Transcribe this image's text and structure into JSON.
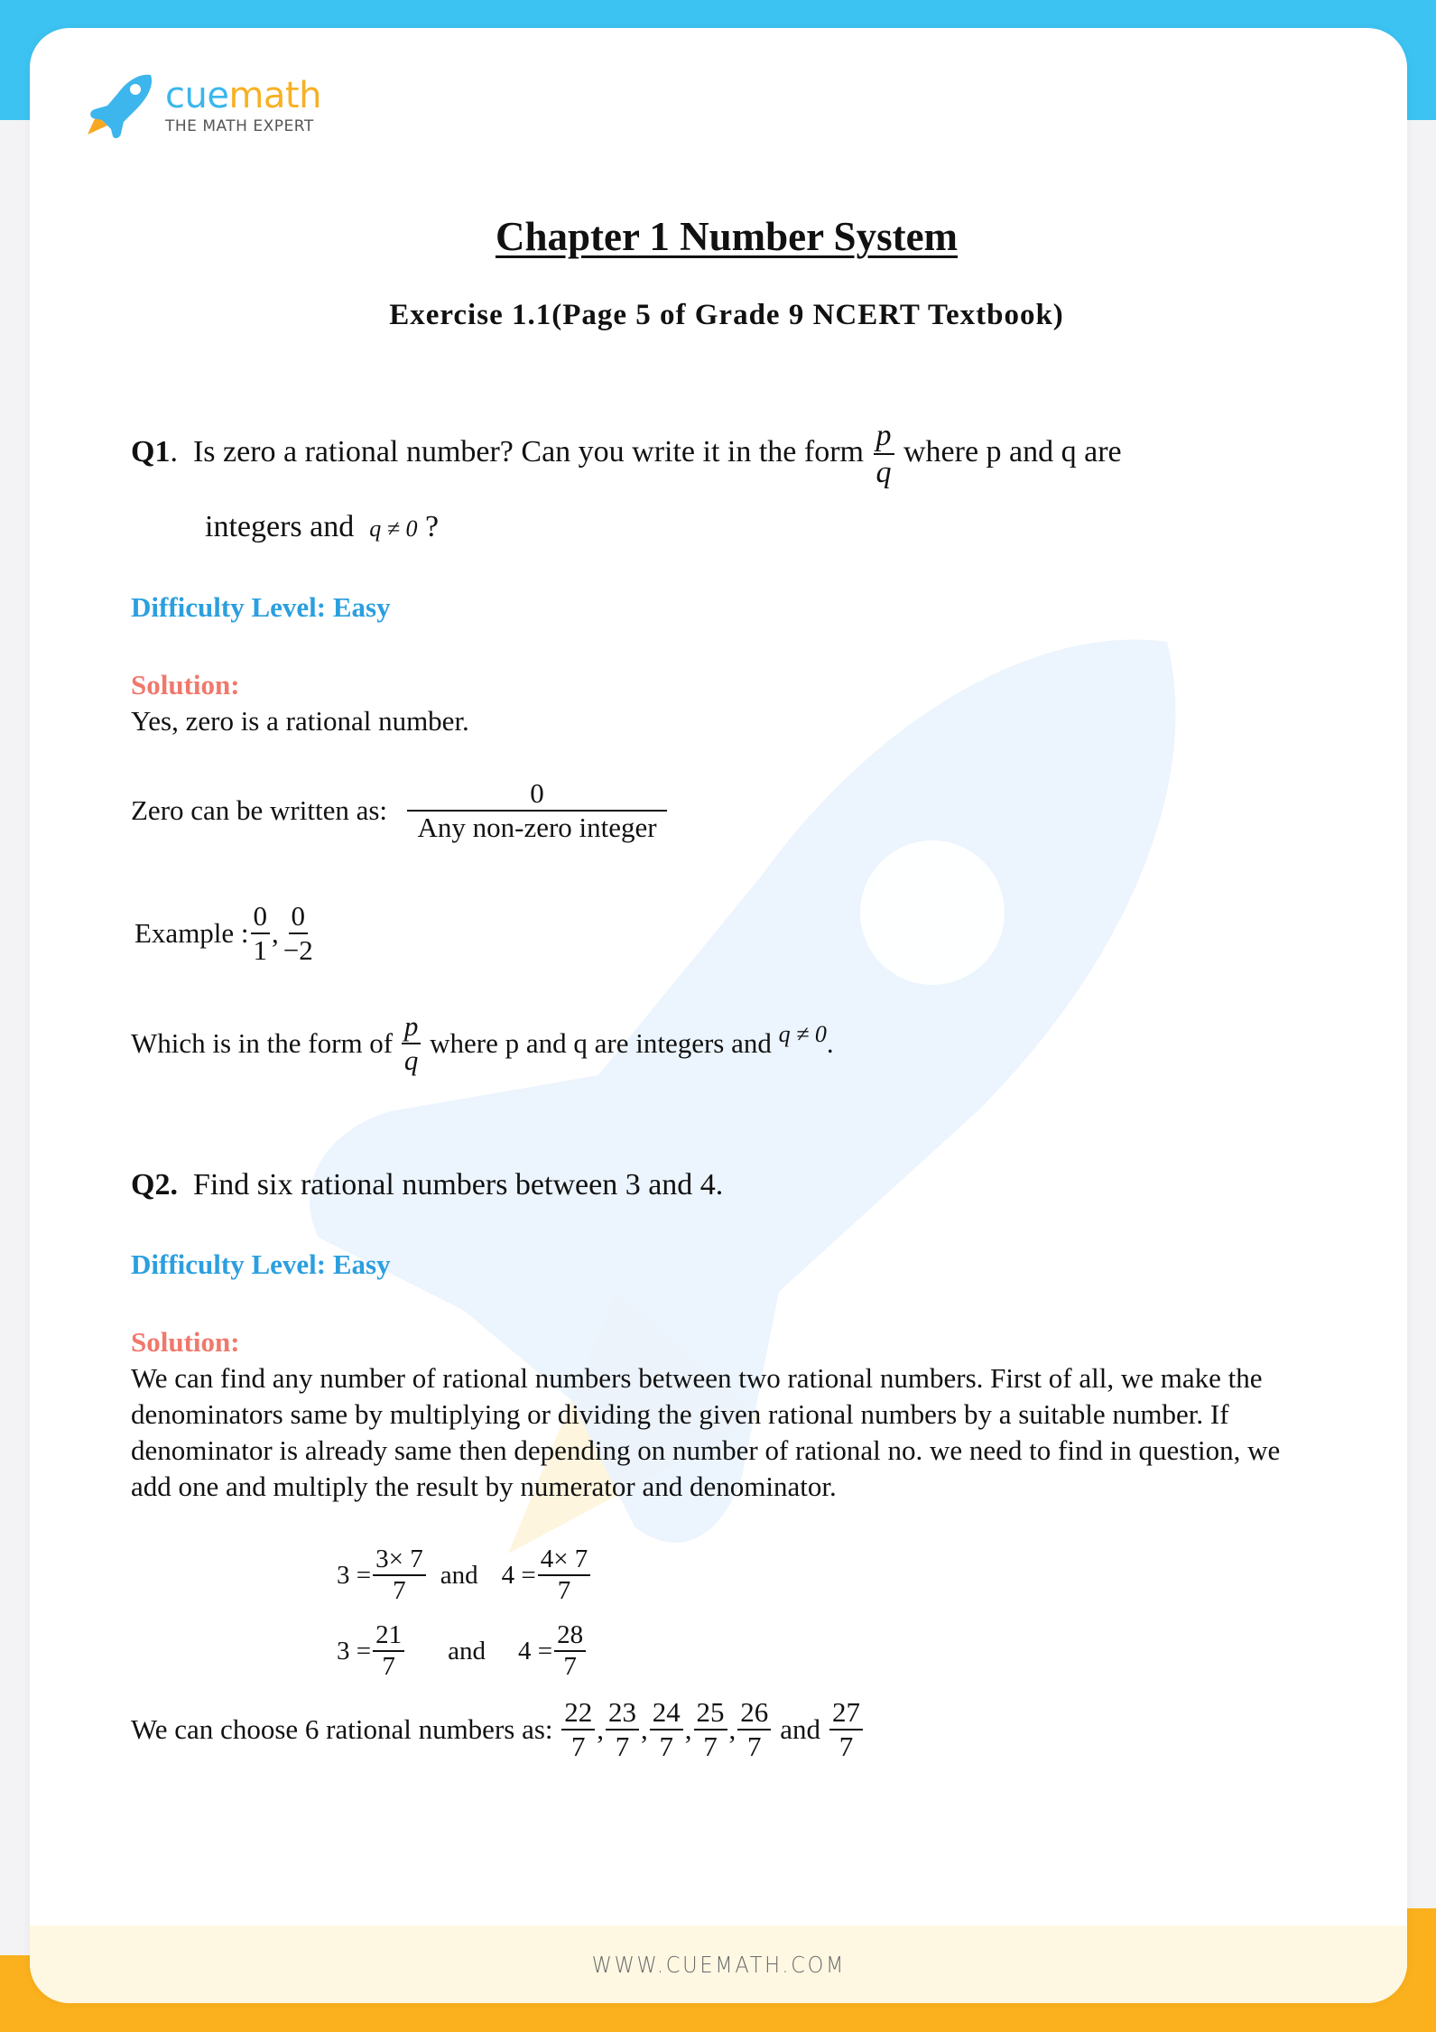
{
  "brand": {
    "name_part1": "cue",
    "name_part2": "math",
    "tagline": "THE MATH EXPERT",
    "colors": {
      "top_band": "#3cc3f2",
      "bottom_band": "#fbb11d",
      "difficulty": "#2c9fdf",
      "solution": "#f1786c",
      "footer_bg": "#fef8e3"
    }
  },
  "header": {
    "title": "Chapter 1 Number System",
    "subtitle": "Exercise 1.1(Page 5 of Grade 9 NCERT Textbook)"
  },
  "q1": {
    "label": "Q1",
    "label_suffix": ".",
    "text_before": "Is zero a rational number? Can you write it in the form",
    "frac_num": "p",
    "frac_den": "q",
    "text_after": "where p and q are",
    "line2": "integers and",
    "condition": "q ≠ 0",
    "line2_end": "?",
    "difficulty": "Difficulty Level: Easy",
    "solution_label": "Solution:",
    "answer": "Yes, zero is a rational number.",
    "written_as_label": "Zero can be written as:",
    "written_as_num": "0",
    "written_as_den": "Any non-zero integer",
    "example_label": "Example :",
    "examples": [
      {
        "num": "0",
        "den": "1"
      },
      {
        "num": "0",
        "den": "−2"
      }
    ],
    "example_sep": ",",
    "form_text_before": "Which is in the form of",
    "form_num": "p",
    "form_den": "q",
    "form_text_after": "where p and q are integers and",
    "form_condition": "q ≠ 0",
    "form_end": "."
  },
  "q2": {
    "label": "Q2.",
    "text": "Find six rational numbers between 3 and 4.",
    "difficulty": "Difficulty Level: Easy",
    "solution_label": "Solution:",
    "paragraph": "We can find any number of rational numbers between two rational numbers. First of all, we make the denominators same by multiplying or dividing the given rational numbers by a suitable number. If denominator is already same then depending on number of rational no. we need to find in question, we add one and multiply the result by numerator and denominator.",
    "eq1": {
      "lhs_a": "3 =",
      "num_a": "3× 7",
      "den_a": "7",
      "and": "and",
      "lhs_b": "4 =",
      "num_b": "4× 7",
      "den_b": "7"
    },
    "eq2": {
      "lhs_a": "3 =",
      "num_a": "21",
      "den_a": "7",
      "and": "and",
      "lhs_b": "4 =",
      "num_b": "28",
      "den_b": "7"
    },
    "choose_text": "We can choose 6 rational numbers as:",
    "answers": [
      {
        "num": "22",
        "den": "7"
      },
      {
        "num": "23",
        "den": "7"
      },
      {
        "num": "24",
        "den": "7"
      },
      {
        "num": "25",
        "den": "7"
      },
      {
        "num": "26",
        "den": "7"
      }
    ],
    "answers_sep": ",",
    "answers_and": "and",
    "answer_last": {
      "num": "27",
      "den": "7"
    }
  },
  "footer": {
    "url": "WWW.CUEMATH.COM"
  }
}
